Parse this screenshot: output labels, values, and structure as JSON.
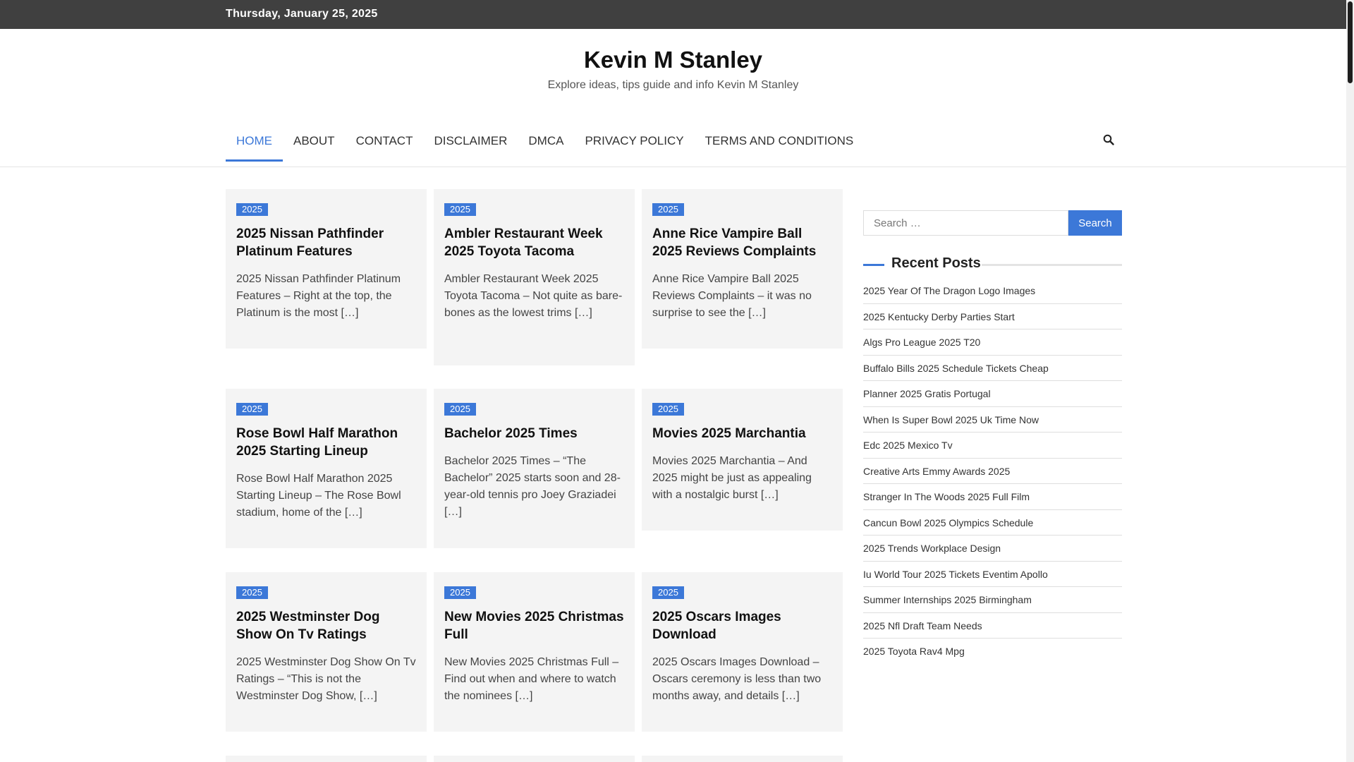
{
  "topbar": {
    "date": "Thursday, January 25, 2025"
  },
  "site": {
    "title": "Kevin M Stanley",
    "tagline": "Explore ideas, tips guide and info Kevin M Stanley"
  },
  "nav": {
    "items": [
      "HOME",
      "ABOUT",
      "CONTACT",
      "DISCLAIMER",
      "DMCA",
      "PRIVACY POLICY",
      "TERMS AND CONDITIONS"
    ],
    "active": "HOME",
    "search_icon": "search-icon"
  },
  "posts": [
    {
      "badge": "2025",
      "title": "2025 Nissan Pathfinder Platinum Features",
      "excerpt": "2025 Nissan Pathfinder Platinum Features – Right at the top, the Platinum is the most […]"
    },
    {
      "badge": "2025",
      "title": "Ambler Restaurant Week 2025 Toyota Tacoma",
      "excerpt": "Ambler Restaurant Week 2025 Toyota Tacoma – Not quite as bare-bones as the lowest trims […]"
    },
    {
      "badge": "2025",
      "title": "Anne Rice Vampire Ball 2025 Reviews Complaints",
      "excerpt": "Anne Rice Vampire Ball 2025 Reviews Complaints – it was no surprise to see the […]"
    },
    {
      "badge": "2025",
      "title": "Rose Bowl Half Marathon 2025 Starting Lineup",
      "excerpt": "Rose Bowl Half Marathon 2025 Starting Lineup – The Rose Bowl stadium, home of the […]"
    },
    {
      "badge": "2025",
      "title": "Bachelor 2025 Times",
      "excerpt": "Bachelor 2025 Times – “The Bachelor” 2025 starts soon and 28-year-old tennis pro Joey Graziadei […]"
    },
    {
      "badge": "2025",
      "title": "Movies 2025 Marchantia",
      "excerpt": "Movies 2025 Marchantia – And 2025 might be just as appealing with a nostalgic burst […]"
    },
    {
      "badge": "2025",
      "title": "2025 Westminster Dog Show On Tv Ratings",
      "excerpt": "2025 Westminster Dog Show On Tv Ratings – “This is not the Westminster Dog Show, […]"
    },
    {
      "badge": "2025",
      "title": "New Movies 2025 Christmas Full",
      "excerpt": "New Movies 2025 Christmas Full – Find out when and where to watch the nominees […]"
    },
    {
      "badge": "2025",
      "title": "2025 Oscars Images Download",
      "excerpt": "2025 Oscars Images Download – Oscars ceremony is less than two months away, and details […]"
    }
  ],
  "sidebar": {
    "search": {
      "placeholder": "Search …",
      "button": "Search"
    },
    "recent_title": "Recent Posts",
    "recent": [
      "2025 Year Of The Dragon Logo Images",
      "2025 Kentucky Derby Parties Start",
      "Algs Pro League 2025 T20",
      "Buffalo Bills 2025 Schedule Tickets Cheap",
      "Planner 2025 Gratis Portugal",
      "When Is Super Bowl 2025 Uk Time Now",
      "Edc 2025 Mexico Tv",
      "Creative Arts Emmy Awards 2025",
      "Stranger In The Woods 2025 Full Film",
      "Cancun Bowl 2025 Olympics Schedule",
      "2025 Trends Workplace Design",
      "Iu World Tour 2025 Tickets Eventim Apollo",
      "Summer Internships 2025 Birmingham",
      "2025 Nfl Draft Team Needs",
      "2025 Toyota Rav4 Mpg"
    ]
  },
  "colors": {
    "accent": "#3c78d8",
    "topbar": "#404040",
    "card": "#f4f4f4"
  }
}
